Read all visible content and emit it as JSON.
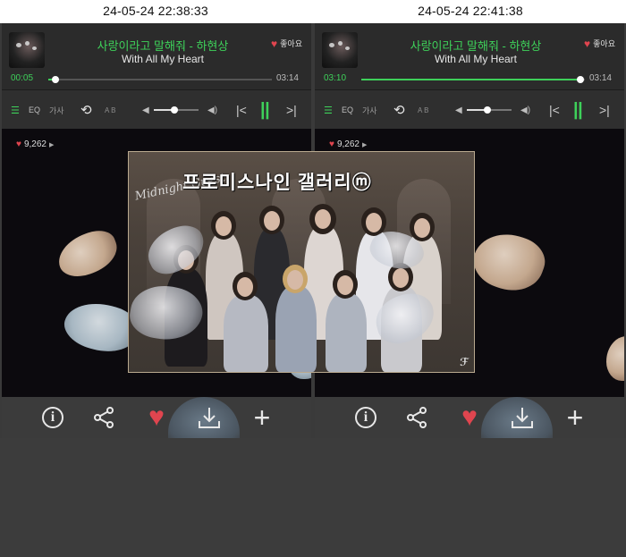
{
  "timestamps": {
    "left": "24-05-24  22:38:33",
    "right": "24-05-24  22:41:38"
  },
  "players": [
    {
      "song_title": "사랑이라고 말해줘 - 하현상",
      "song_subtitle": "With All My Heart",
      "like_label": "좋아요",
      "current_time": "00:05",
      "total_time": "03:14",
      "progress_fraction": 0.03,
      "eq_label": "EQ",
      "lyrics_label": "가사",
      "ab_label": "A  B",
      "volume_fraction": 0.45,
      "like_count": "9,262"
    },
    {
      "song_title": "사랑이라고 말해줘 - 하현상",
      "song_subtitle": "With All My Heart",
      "like_label": "좋아요",
      "current_time": "03:10",
      "total_time": "03:14",
      "progress_fraction": 0.98,
      "eq_label": "EQ",
      "lyrics_label": "가사",
      "ab_label": "A  B",
      "volume_fraction": 0.45,
      "like_count": "9,262"
    }
  ],
  "overlay": {
    "title": "프로미스나인 갤러리ⓜ",
    "script_text": "Midnight Guest",
    "mark": "ℱ"
  },
  "icons": {
    "like": "heart-icon",
    "list": "playlist-icon",
    "repeat": "repeat-icon",
    "volume_down": "volume-down-icon",
    "volume_up": "volume-up-icon",
    "prev": "previous-icon",
    "pause": "pause-icon",
    "next": "next-icon",
    "info": "info-icon",
    "share": "share-icon",
    "download": "download-icon",
    "add": "plus-icon"
  },
  "colors": {
    "accent": "#3ed15a",
    "heart": "#e0454f",
    "background": "#232323"
  }
}
